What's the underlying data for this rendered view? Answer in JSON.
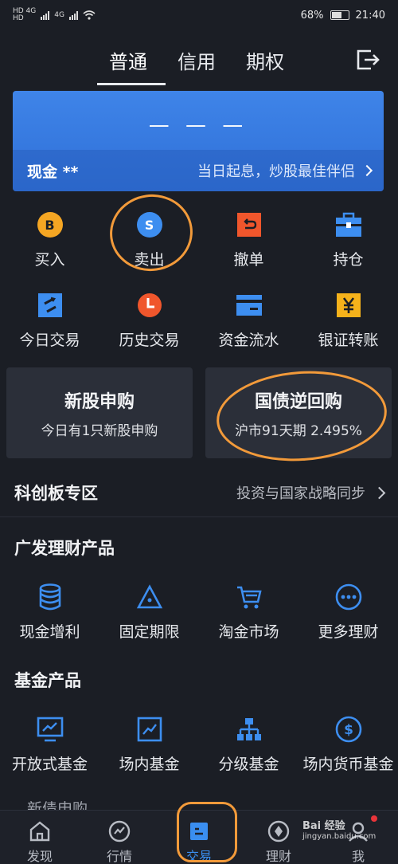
{
  "status": {
    "left_line1": "HD 4G",
    "left_line2": "HD",
    "net2": "4G",
    "battery": "68%",
    "battery_level": 0.68,
    "time": "21:40"
  },
  "topnav": {
    "tabs": [
      "普通",
      "信用",
      "期权"
    ],
    "active": 0
  },
  "cash_card": {
    "amount_placeholder": "— — —",
    "label": "现金 **",
    "slogan": "当日起息，炒股最佳伴侣"
  },
  "quick_actions": [
    {
      "label": "买入",
      "icon": "buy-icon",
      "glyph": "B",
      "color": "#f5a623"
    },
    {
      "label": "卖出",
      "icon": "sell-icon",
      "glyph": "S",
      "color": "#3d8ef0"
    },
    {
      "label": "撤单",
      "icon": "undo-order-icon",
      "glyph": "⊃",
      "color": "#f0562c"
    },
    {
      "label": "持仓",
      "icon": "briefcase-icon",
      "glyph": "",
      "color": "#3d8ef0"
    }
  ],
  "quick_actions2": [
    {
      "label": "今日交易",
      "icon": "today-trade-icon",
      "color": "#3d8ef0"
    },
    {
      "label": "历史交易",
      "icon": "history-clock-icon",
      "color": "#f0562c"
    },
    {
      "label": "资金流水",
      "icon": "card-icon",
      "color": "#3d8ef0"
    },
    {
      "label": "银证转账",
      "icon": "yen-transfer-icon",
      "color": "#f5b21b"
    }
  ],
  "promo": [
    {
      "title": "新股申购",
      "sub": "今日有1只新股申购"
    },
    {
      "title": "国债逆回购",
      "sub": "沪市91天期 2.495%"
    }
  ],
  "star_market": {
    "title": "科创板专区",
    "sub": "投资与国家战略同步"
  },
  "wealth": {
    "title": "广发理财产品",
    "items": [
      {
        "label": "现金增利",
        "icon": "coins-stack-icon"
      },
      {
        "label": "固定期限",
        "icon": "triangle-icon"
      },
      {
        "label": "淘金市场",
        "icon": "cart-icon"
      },
      {
        "label": "更多理财",
        "icon": "more-dots-icon"
      }
    ]
  },
  "funds": {
    "title": "基金产品",
    "items": [
      {
        "label": "开放式基金",
        "icon": "monitor-chart-icon"
      },
      {
        "label": "场内基金",
        "icon": "trend-chart-icon"
      },
      {
        "label": "分级基金",
        "icon": "hierarchy-icon"
      },
      {
        "label": "场内货币基金",
        "icon": "dollar-coin-icon"
      }
    ]
  },
  "partial_row": "新债申购",
  "bottom_tabs": [
    {
      "label": "发现",
      "icon": "home-icon"
    },
    {
      "label": "行情",
      "icon": "market-chart-icon"
    },
    {
      "label": "交易",
      "icon": "trade-icon"
    },
    {
      "label": "理财",
      "icon": "wealth-compass-icon"
    },
    {
      "label": "我",
      "icon": "profile-icon"
    }
  ],
  "bottom_active": 2,
  "watermark": {
    "line1": "Bai 经验",
    "line2": "jingyan.baidu.com"
  },
  "colors": {
    "accent": "#3a8ef0",
    "highlight": "#f29a3a",
    "background": "#1b1e25"
  }
}
